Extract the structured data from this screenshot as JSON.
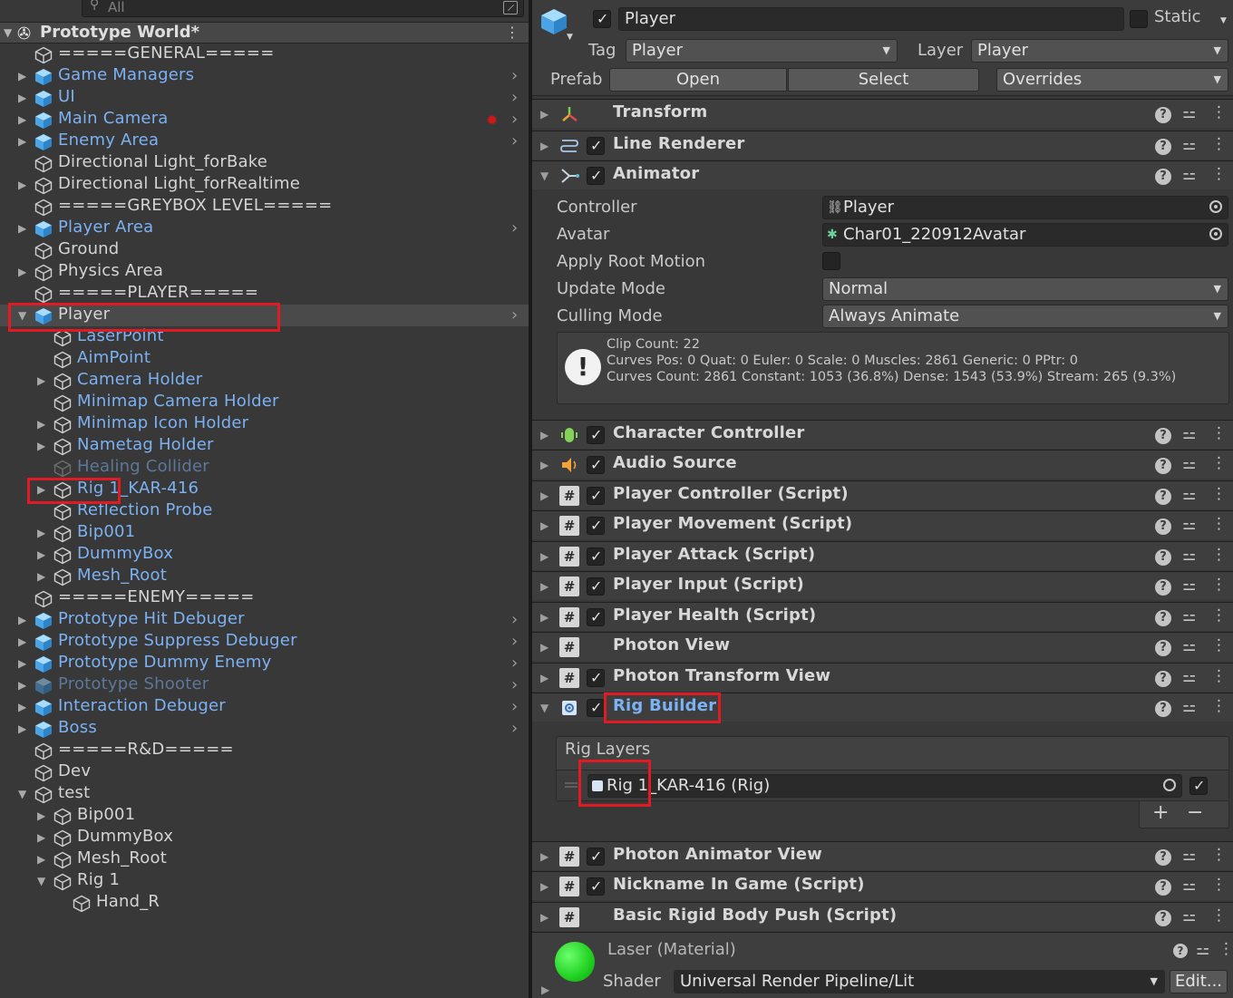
{
  "hierarchy": {
    "search": {
      "value": "All"
    },
    "scene_title": "Prototype World*",
    "rows": [
      {
        "label": "=====GENERAL=====",
        "style": "normal",
        "fold": "",
        "icon": "gameobject",
        "arrow": false
      },
      {
        "label": "Game Managers",
        "style": "prefab",
        "fold": "▶",
        "icon": "prefab",
        "arrow": true
      },
      {
        "label": "UI",
        "style": "prefab",
        "fold": "▶",
        "icon": "prefab",
        "arrow": true
      },
      {
        "label": "Main Camera",
        "style": "prefab",
        "fold": "▶",
        "icon": "prefab",
        "arrow": true,
        "scene_vis": true
      },
      {
        "label": "Enemy Area",
        "style": "prefab",
        "fold": "▶",
        "icon": "prefab",
        "arrow": true
      },
      {
        "label": "Directional Light_forBake",
        "style": "normal",
        "fold": "",
        "icon": "gameobject",
        "arrow": false
      },
      {
        "label": "Directional Light_forRealtime",
        "style": "normal",
        "fold": "▶",
        "icon": "gameobject",
        "arrow": false
      },
      {
        "label": "=====GREYBOX LEVEL=====",
        "style": "normal",
        "fold": "",
        "icon": "gameobject",
        "arrow": false
      },
      {
        "label": "Player Area",
        "style": "prefab",
        "fold": "▶",
        "icon": "prefab",
        "arrow": true
      },
      {
        "label": "Ground",
        "style": "normal",
        "fold": "",
        "icon": "gameobject",
        "arrow": false
      },
      {
        "label": "Physics Area",
        "style": "normal",
        "fold": "▶",
        "icon": "gameobject",
        "arrow": false
      },
      {
        "label": "=====PLAYER=====",
        "style": "normal",
        "fold": "",
        "icon": "gameobject",
        "arrow": false
      },
      {
        "label": "Player",
        "style": "normal",
        "fold": "▼",
        "icon": "prefab",
        "arrow": true,
        "selected": true
      },
      {
        "label": "LaserPoint",
        "style": "prefab",
        "fold": "",
        "icon": "gameobject",
        "arrow": false,
        "indent": 1
      },
      {
        "label": "AimPoint",
        "style": "prefab",
        "fold": "",
        "icon": "gameobject",
        "arrow": false,
        "indent": 1
      },
      {
        "label": "Camera Holder",
        "style": "prefab",
        "fold": "▶",
        "icon": "gameobject",
        "arrow": false,
        "indent": 1
      },
      {
        "label": "Minimap Camera Holder",
        "style": "prefab",
        "fold": "",
        "icon": "gameobject",
        "arrow": false,
        "indent": 1
      },
      {
        "label": "Minimap Icon Holder",
        "style": "prefab",
        "fold": "▶",
        "icon": "gameobject",
        "arrow": false,
        "indent": 1
      },
      {
        "label": "Nametag Holder",
        "style": "prefab",
        "fold": "▶",
        "icon": "gameobject",
        "arrow": false,
        "indent": 1
      },
      {
        "label": "Healing Collider",
        "style": "disabled",
        "fold": "",
        "icon": "gameobject",
        "arrow": false,
        "indent": 1
      },
      {
        "label": "Rig 1_KAR-416",
        "style": "prefab",
        "fold": "▶",
        "icon": "gameobject",
        "arrow": false,
        "indent": 1
      },
      {
        "label": "Reflection Probe",
        "style": "prefab",
        "fold": "",
        "icon": "gameobject",
        "arrow": false,
        "indent": 1
      },
      {
        "label": "Bip001",
        "style": "prefab",
        "fold": "▶",
        "icon": "gameobject",
        "arrow": false,
        "indent": 1
      },
      {
        "label": "DummyBox",
        "style": "prefab",
        "fold": "▶",
        "icon": "gameobject",
        "arrow": false,
        "indent": 1
      },
      {
        "label": "Mesh_Root",
        "style": "prefab",
        "fold": "▶",
        "icon": "gameobject",
        "arrow": false,
        "indent": 1
      },
      {
        "label": "=====ENEMY=====",
        "style": "normal",
        "fold": "",
        "icon": "gameobject",
        "arrow": false
      },
      {
        "label": "Prototype Hit Debuger",
        "style": "prefab",
        "fold": "▶",
        "icon": "prefab",
        "arrow": true
      },
      {
        "label": "Prototype Suppress Debuger",
        "style": "prefab",
        "fold": "▶",
        "icon": "prefab",
        "arrow": true
      },
      {
        "label": "Prototype Dummy Enemy",
        "style": "prefab",
        "fold": "▶",
        "icon": "prefab",
        "arrow": true
      },
      {
        "label": "Prototype Shooter",
        "style": "disabled",
        "fold": "▶",
        "icon": "prefab-disabled",
        "arrow": true
      },
      {
        "label": "Interaction Debuger",
        "style": "prefab",
        "fold": "▶",
        "icon": "prefab",
        "arrow": true
      },
      {
        "label": "Boss",
        "style": "prefab",
        "fold": "▶",
        "icon": "prefab",
        "arrow": true
      },
      {
        "label": "=====R&D=====",
        "style": "normal",
        "fold": "",
        "icon": "gameobject",
        "arrow": false
      },
      {
        "label": "Dev",
        "style": "normal",
        "fold": "",
        "icon": "gameobject",
        "arrow": false
      },
      {
        "label": "test",
        "style": "normal",
        "fold": "▼",
        "icon": "gameobject",
        "arrow": false
      },
      {
        "label": "Bip001",
        "style": "normal",
        "fold": "▶",
        "icon": "gameobject",
        "arrow": false,
        "indent": 1
      },
      {
        "label": "DummyBox",
        "style": "normal",
        "fold": "▶",
        "icon": "gameobject",
        "arrow": false,
        "indent": 1
      },
      {
        "label": "Mesh_Root",
        "style": "normal",
        "fold": "▶",
        "icon": "gameobject",
        "arrow": false,
        "indent": 1
      },
      {
        "label": "Rig 1",
        "style": "normal",
        "fold": "▼",
        "icon": "gameobject",
        "arrow": false,
        "indent": 1
      },
      {
        "label": "Hand_R",
        "style": "normal",
        "fold": "",
        "icon": "gameobject",
        "arrow": false,
        "indent": 2
      }
    ]
  },
  "inspector": {
    "object_name": "Player",
    "static_label": "Static",
    "tag_label": "Tag",
    "tag_value": "Player",
    "layer_label": "Layer",
    "layer_value": "Player",
    "prefab_label": "Prefab",
    "prefab_open": "Open",
    "prefab_select": "Select",
    "prefab_overrides": "Overrides",
    "components_top": [
      {
        "name": "Transform",
        "icon": "transform-icon",
        "checkbox": false
      },
      {
        "name": "Line Renderer",
        "icon": "line-renderer-icon",
        "checkbox": true
      },
      {
        "name": "Animator",
        "icon": "animator-icon",
        "checkbox": true,
        "expanded": true
      }
    ],
    "animator": {
      "controller_label": "Controller",
      "controller_value": "Player",
      "avatar_label": "Avatar",
      "avatar_value": "Char01_220912Avatar",
      "root_motion_label": "Apply Root Motion",
      "update_mode_label": "Update Mode",
      "update_mode_value": "Normal",
      "culling_mode_label": "Culling Mode",
      "culling_mode_value": "Always Animate",
      "info_lines": [
        "Clip Count: 22",
        "Curves Pos: 0 Quat: 0 Euler: 0 Scale: 0 Muscles: 2861 Generic: 0 PPtr: 0",
        "Curves Count: 2861 Constant: 1053 (36.8%) Dense: 1543 (53.9%) Stream: 265 (9.3%)"
      ]
    },
    "components_mid": [
      {
        "name": "Character Controller",
        "icon": "character-controller-icon",
        "checkbox": true
      },
      {
        "name": "Audio Source",
        "icon": "audio-source-icon",
        "checkbox": true
      },
      {
        "name": "Player Controller (Script)",
        "icon": "script-icon",
        "checkbox": true
      },
      {
        "name": "Player Movement (Script)",
        "icon": "script-icon",
        "checkbox": true
      },
      {
        "name": "Player Attack (Script)",
        "icon": "script-icon",
        "checkbox": true
      },
      {
        "name": "Player Input (Script)",
        "icon": "script-icon",
        "checkbox": true
      },
      {
        "name": "Player Health (Script)",
        "icon": "script-icon",
        "checkbox": true
      },
      {
        "name": "Photon View",
        "icon": "script-icon",
        "checkbox": false
      },
      {
        "name": "Photon Transform View",
        "icon": "script-icon",
        "checkbox": true
      },
      {
        "name": "Rig Builder",
        "icon": "rig-builder-icon",
        "checkbox": true,
        "expanded": true,
        "highlight": true
      }
    ],
    "rig_builder": {
      "rig_layers_label": "Rig Layers",
      "layer_value": "Rig 1_KAR-416 (Rig)",
      "add_label": "+",
      "remove_label": "−"
    },
    "components_bottom": [
      {
        "name": "Photon Animator View",
        "icon": "script-icon",
        "checkbox": true
      },
      {
        "name": "Nickname In Game (Script)",
        "icon": "script-icon",
        "checkbox": true
      },
      {
        "name": "Basic Rigid Body Push (Script)",
        "icon": "script-icon",
        "checkbox": false
      }
    ],
    "material": {
      "name": "Laser (Material)",
      "shader_label": "Shader",
      "shader_value": "Universal Render Pipeline/Lit",
      "edit_label": "Edit...",
      "sphere_color": "#22d022"
    }
  },
  "colors": {
    "prefab_blue": "#7cb1f2",
    "highlight_red": "#e01b24",
    "panel_bg": "#383838"
  }
}
